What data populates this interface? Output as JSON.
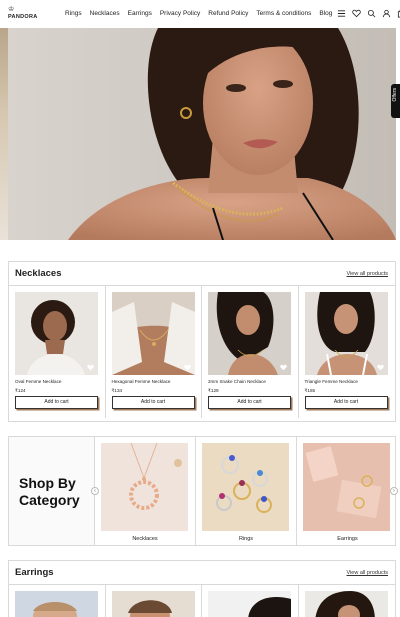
{
  "brand": {
    "logo_text": "PANDORA"
  },
  "nav": {
    "items": [
      "Rings",
      "Necklaces",
      "Earrings",
      "Privacy Policy",
      "Refund Policy",
      "Terms & conditions",
      "Blog"
    ]
  },
  "hero": {
    "offers_tab": "Offers"
  },
  "necklaces": {
    "title": "Necklaces",
    "view_all": "View all products",
    "products": [
      {
        "name": "Oval Femme Necklace",
        "price": "₹124",
        "button": "Add to cart"
      },
      {
        "name": "Hexagonal Femme Necklace",
        "price": "₹134",
        "button": "Add to cart"
      },
      {
        "name": "2mm Snake Chain Necklace",
        "price": "₹129",
        "button": "Add to cart"
      },
      {
        "name": "Triangle Femme Necklace",
        "price": "₹155",
        "button": "Add to cart"
      }
    ]
  },
  "category": {
    "title_line1": "Shop By",
    "title_line2": "Category",
    "items": [
      {
        "label": "Necklaces"
      },
      {
        "label": "Rings"
      },
      {
        "label": "Earrings"
      }
    ]
  },
  "earrings": {
    "title": "Earrings",
    "view_all": "View all products"
  },
  "colors": {
    "accent_shadow": "#a07a5a",
    "border": "#d9d9d9"
  }
}
